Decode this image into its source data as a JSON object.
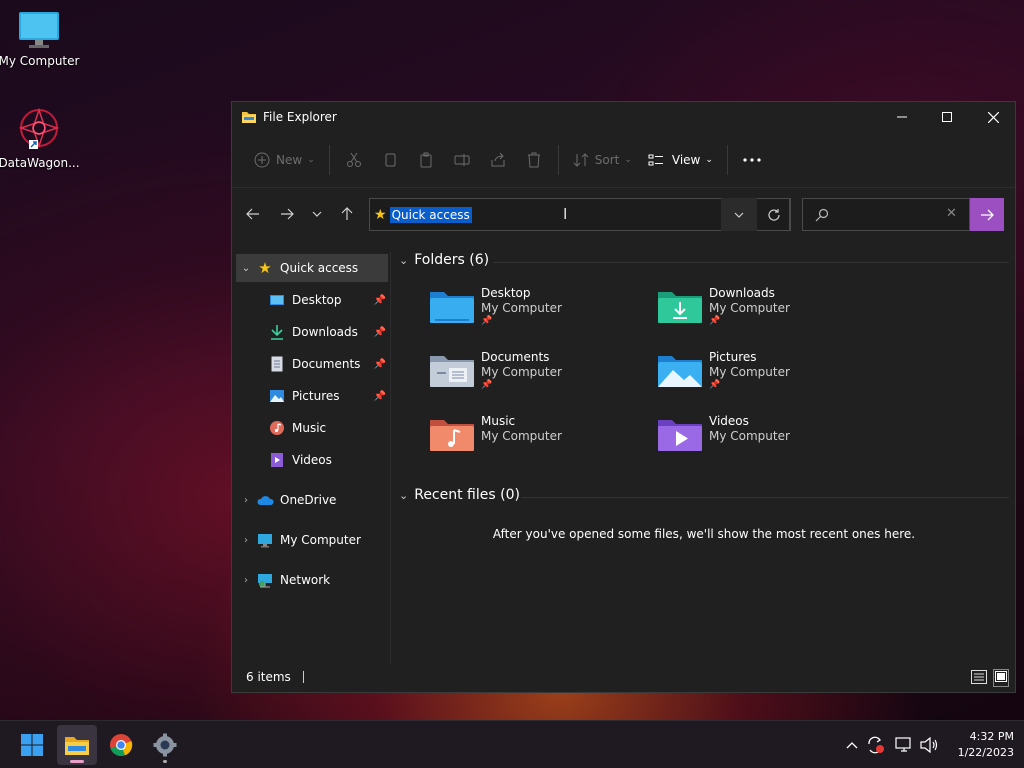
{
  "desktop": {
    "icons": [
      {
        "label": "My Computer"
      },
      {
        "label": "DataWagon..."
      }
    ]
  },
  "window": {
    "title": "File Explorer",
    "toolbar": {
      "new_label": "New",
      "sort_label": "Sort",
      "view_label": "View"
    },
    "address": {
      "value": "Quick access"
    },
    "search": {
      "placeholder": ""
    }
  },
  "sidebar": {
    "quick_access": "Quick access",
    "pinned": [
      {
        "label": "Desktop"
      },
      {
        "label": "Downloads"
      },
      {
        "label": "Documents"
      },
      {
        "label": "Pictures"
      },
      {
        "label": "Music"
      },
      {
        "label": "Videos"
      }
    ],
    "onedrive": "OneDrive",
    "my_computer": "My Computer",
    "network": "Network"
  },
  "content": {
    "folders_header": "Folders (6)",
    "folders": [
      {
        "name": "Desktop",
        "location": "My Computer"
      },
      {
        "name": "Downloads",
        "location": "My Computer"
      },
      {
        "name": "Documents",
        "location": "My Computer"
      },
      {
        "name": "Pictures",
        "location": "My Computer"
      },
      {
        "name": "Music",
        "location": "My Computer"
      },
      {
        "name": "Videos",
        "location": "My Computer"
      }
    ],
    "recent_header": "Recent files (0)",
    "recent_empty": "After you've opened some files, we'll show the most recent ones here."
  },
  "status": {
    "items": "6 items"
  },
  "taskbar": {
    "time": "4:32 PM",
    "date": "1/22/2023"
  },
  "colors": {
    "accent": "#9b4fc0",
    "selection": "#0a5ecb",
    "window_bg": "#202020"
  }
}
